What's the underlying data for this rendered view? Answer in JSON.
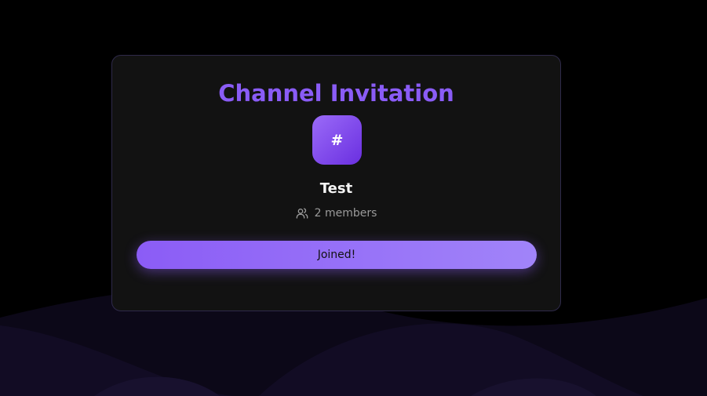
{
  "invitation": {
    "title": "Channel Invitation",
    "channel_icon_symbol": "#",
    "channel_name": "Test",
    "member_count_text": "2 members",
    "members_icon": "users-icon",
    "join_button_label": "Joined!"
  },
  "theme": {
    "accent": "#8a5cf6",
    "background": "#000000",
    "card_background": "#121212"
  }
}
